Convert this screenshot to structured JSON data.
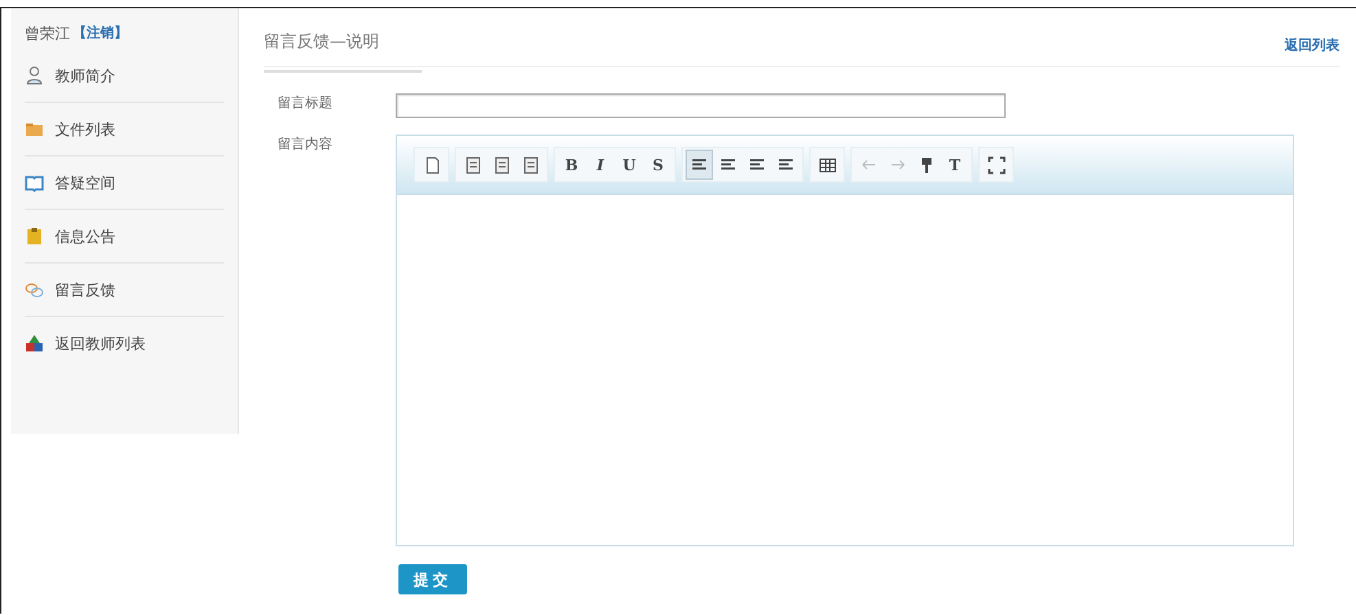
{
  "sidebar": {
    "user": "曾荣江",
    "logout": "【注销】",
    "items": [
      {
        "label": "教师简介",
        "kind": "person"
      },
      {
        "label": "文件列表",
        "kind": "folder"
      },
      {
        "label": "答疑空间",
        "kind": "book"
      },
      {
        "label": "信息公告",
        "kind": "notice"
      },
      {
        "label": "留言反馈",
        "kind": "chat"
      },
      {
        "label": "返回教师列表",
        "kind": "shapes"
      }
    ]
  },
  "header": {
    "title": "留言反馈—说明",
    "back_link": "返回列表"
  },
  "form": {
    "title_label": "留言标题",
    "content_label": "留言内容",
    "toolbar": [
      [
        {
          "kind": "source",
          "selected": false,
          "disabled": false
        }
      ],
      [
        {
          "kind": "paste",
          "selected": false,
          "disabled": false
        },
        {
          "kind": "paste",
          "selected": false,
          "disabled": false
        },
        {
          "kind": "paste",
          "selected": false,
          "disabled": false
        }
      ],
      [
        {
          "kind": "letter",
          "label": "B",
          "selected": false,
          "disabled": false
        },
        {
          "kind": "letter",
          "label": "I",
          "selected": false,
          "disabled": false
        },
        {
          "kind": "letter",
          "label": "U",
          "selected": false,
          "disabled": false
        },
        {
          "kind": "letter",
          "label": "S",
          "selected": false,
          "disabled": false
        }
      ],
      [
        {
          "kind": "align",
          "selected": true,
          "disabled": false
        },
        {
          "kind": "align",
          "selected": false,
          "disabled": false
        },
        {
          "kind": "align",
          "selected": false,
          "disabled": false
        },
        {
          "kind": "align",
          "selected": false,
          "disabled": false
        }
      ],
      [
        {
          "kind": "table",
          "selected": false,
          "disabled": false
        }
      ],
      [
        {
          "kind": "undo",
          "selected": false,
          "disabled": true
        },
        {
          "kind": "redo",
          "selected": false,
          "disabled": true
        },
        {
          "kind": "brush",
          "selected": false,
          "disabled": false
        },
        {
          "kind": "letter",
          "label": "T",
          "selected": false,
          "disabled": false
        }
      ],
      [
        {
          "kind": "fullscreen",
          "selected": false,
          "disabled": false
        }
      ]
    ],
    "submit": "提交"
  }
}
